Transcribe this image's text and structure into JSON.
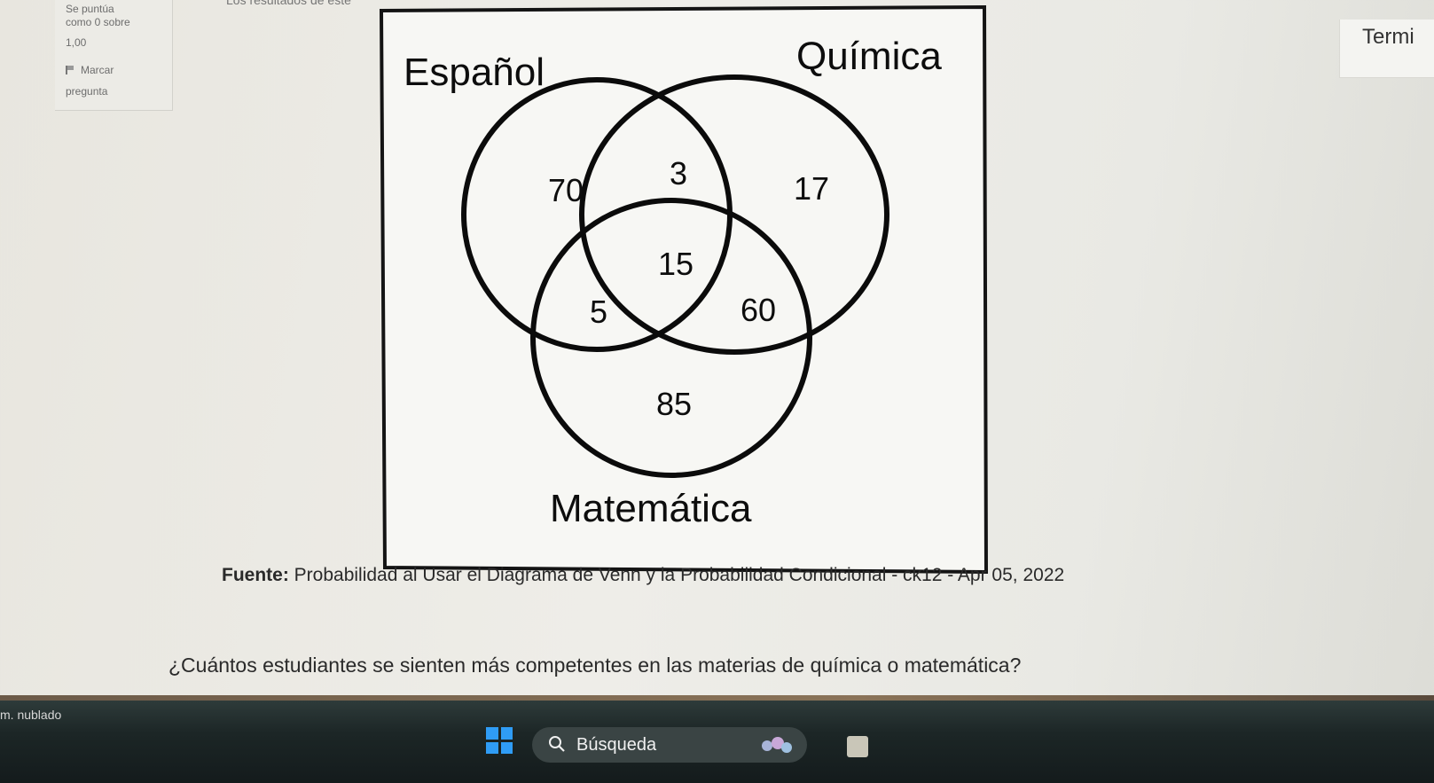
{
  "info_box": {
    "line1": "Se puntúa",
    "line2": "como 0 sobre",
    "line3": "1,00",
    "flag_label": "Marcar",
    "flag_label2": "pregunta"
  },
  "top_text": "Los resultados de este",
  "finish_button": "Termi",
  "venn": {
    "labels": {
      "espanol": "Español",
      "quimica": "Química",
      "matematica": "Matemática"
    },
    "regions": {
      "only_espanol": "70",
      "espanol_quimica": "3",
      "only_quimica": "17",
      "all_three": "15",
      "espanol_matematica": "5",
      "quimica_matematica": "60",
      "only_matematica": "85"
    }
  },
  "source": {
    "bold": "Fuente:",
    "text": " Probabilidad al Usar el Diagrama de Venn y la Probabilidad Condicional - ck12 - Apr 05, 2022"
  },
  "question": "¿Cuántos estudiantes se sienten más competentes en las materias de química o matemática?",
  "taskbar": {
    "weather": "m. nublado",
    "search_label": "Búsqueda"
  }
}
